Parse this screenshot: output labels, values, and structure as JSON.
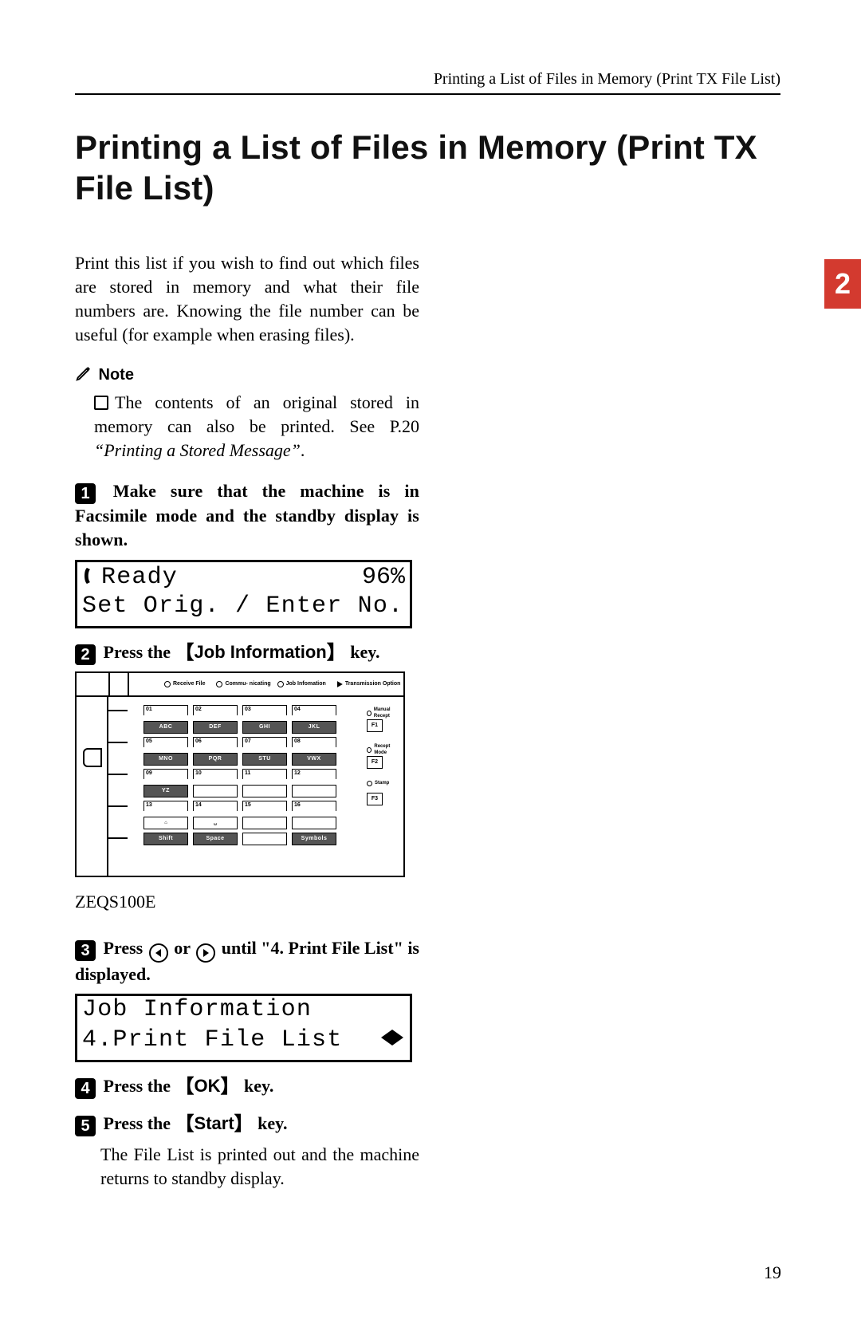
{
  "running_head": "Printing a List of Files in Memory (Print TX File List)",
  "title": "Printing a List of Files in Memory (Print TX File List)",
  "chapter": "2",
  "page_number": "19",
  "intro": "Print this list if you wish to find out which files are stored in memory and what their file numbers are. Knowing the file number can be useful (for example when erasing files).",
  "note_label": "Note",
  "note_body_1": "The contents of an original stored in memory can also be printed. See P.20 ",
  "note_ref": "“Printing a Stored Message”",
  "note_body_2": ".",
  "steps": {
    "s1": {
      "n": "1",
      "text": "Make sure that the machine is in Facsimile mode and the standby display is shown."
    },
    "s2": {
      "n": "2",
      "pre": "Press the ",
      "key": "Job Information",
      "post": " key."
    },
    "s3": {
      "n": "3",
      "pre": "Press ",
      "mid": " or ",
      "post": " until \"4. Print File List\" is displayed."
    },
    "s4": {
      "n": "4",
      "pre": "Press the ",
      "key": "OK",
      "post": " key."
    },
    "s5": {
      "n": "5",
      "pre": "Press the ",
      "key": "Start",
      "post": " key."
    }
  },
  "lcd1": {
    "l1a": "Ready",
    "l1b": "96%",
    "l2": "Set Orig. / Enter No."
  },
  "lcd2": {
    "l1": "Job Information",
    "l2": "4.Print File List"
  },
  "outro": "The File List is printed out and the machine returns to standby display.",
  "panel": {
    "top": {
      "receive": "Receive File",
      "commu": "Commu- nicating",
      "job": "Job Infomation",
      "tx": "Transmission Option"
    },
    "rows": [
      {
        "nums": [
          "01",
          "02",
          "03",
          "04"
        ],
        "labels": [
          "ABC",
          "DEF",
          "GHI",
          "JKL"
        ],
        "dark": true
      },
      {
        "nums": [
          "05",
          "06",
          "07",
          "08"
        ],
        "labels": [
          "MNO",
          "PQR",
          "STU",
          "VWX"
        ],
        "dark": true
      },
      {
        "nums": [
          "09",
          "10",
          "11",
          "12"
        ],
        "labels": [
          "YZ",
          "",
          "",
          ""
        ],
        "dark": [
          true,
          false,
          false,
          false
        ]
      },
      {
        "nums": [
          "13",
          "14",
          "15",
          "16"
        ],
        "labels": [
          "⌂",
          "␣",
          "",
          ""
        ],
        "dark": false,
        "special": true
      }
    ],
    "bottom": [
      "Shift",
      "Space",
      "",
      "Symbols"
    ],
    "right": {
      "r1": "Manual Recept",
      "r2": "Recept Mode",
      "r3": "Stamp",
      "f1": "F1",
      "f2": "F2",
      "f3": "F3"
    },
    "code": "ZEQS100E"
  }
}
